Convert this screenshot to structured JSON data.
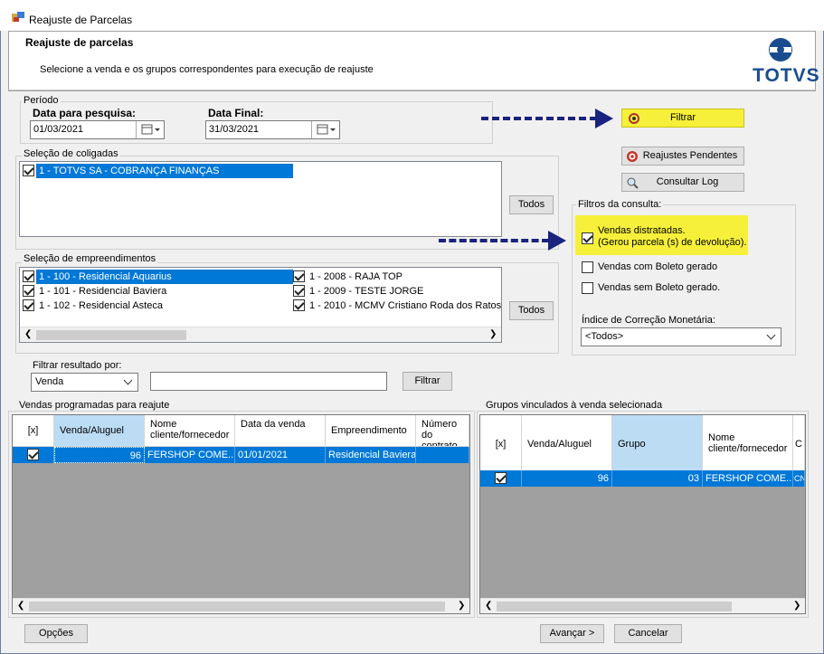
{
  "window": {
    "title": "Reajuste de Parcelas"
  },
  "header": {
    "title": "Reajuste de parcelas",
    "subtitle": "Selecione a venda e os grupos correspondentes para execução de reajuste",
    "logo": "TOTVS"
  },
  "periodo": {
    "group_label": "Período",
    "start_label": "Data para pesquisa:",
    "start_value": "01/03/2021",
    "end_label": "Data Final:",
    "end_value": "31/03/2021"
  },
  "buttons": {
    "filtrar": "Filtrar",
    "reajustes_pendentes": "Reajustes Pendentes",
    "consultar_log": "Consultar Log",
    "todos_coligadas": "Todos",
    "todos_emp": "Todos",
    "filtrar_resultado": "Filtrar",
    "opcoes": "Opções",
    "avancar": "Avançar >",
    "cancelar": "Cancelar"
  },
  "coligadas": {
    "group_label": "Seleção de coligadas",
    "items": [
      {
        "label": "1 - TOTVS SA - COBRANÇA FINANÇAS",
        "checked": true
      }
    ]
  },
  "empreendimentos": {
    "group_label": "Seleção de empreendimentos",
    "items": [
      {
        "label": "1 - 100 - Residencial Aquarius",
        "checked": true
      },
      {
        "label": "1 - 101 - Residencial Baviera",
        "checked": true
      },
      {
        "label": "1 - 102 - Residencial Asteca",
        "checked": true
      },
      {
        "label": "1 - 2008 - RAJA TOP",
        "checked": true
      },
      {
        "label": "1 - 2009 - TESTE JORGE",
        "checked": true
      },
      {
        "label": "1 - 2010 - MCMV Cristiano Roda dos Ratos",
        "checked": true
      }
    ]
  },
  "filtros": {
    "group_label": "Filtros da consulta:",
    "distratadas_line1": "Vendas distratadas.",
    "distratadas_line2": "(Gerou parcela (s) de devolução).",
    "boleto_gerado": "Vendas com Boleto gerado",
    "sem_boleto": "Vendas sem Boleto gerado.",
    "indice_label": "Índice de Correção Monetária:",
    "indice_value": "<Todos>"
  },
  "filtrar_resultado": {
    "label": "Filtrar resultado por:",
    "value": "Venda",
    "text": ""
  },
  "vendas_grid": {
    "group_label": "Vendas programadas para reajute",
    "headers": [
      "[x]",
      "Venda/Aluguel",
      "Nome cliente/fornecedor",
      "Data da venda",
      "Empreendimento",
      "Número do contrato"
    ],
    "rows": [
      {
        "venda": "96",
        "nome": "FERSHOP COME...",
        "data": "01/01/2021",
        "empreendimento": "Residencial Baviera",
        "contrato": ""
      }
    ]
  },
  "grupos_grid": {
    "group_label": "Grupos vinculados à venda selecionada",
    "headers": [
      "[x]",
      "Venda/Aluguel",
      "Grupo",
      "Nome cliente/fornecedor",
      "C"
    ],
    "rows": [
      {
        "venda": "96",
        "grupo": "03",
        "nome": "FERSHOP COME...",
        "extra": "CN"
      }
    ]
  },
  "colors": {
    "selection": "#0078d7",
    "highlight": "#f6f03a",
    "arrow": "#1a237e",
    "logo": "#1a4d8f"
  }
}
